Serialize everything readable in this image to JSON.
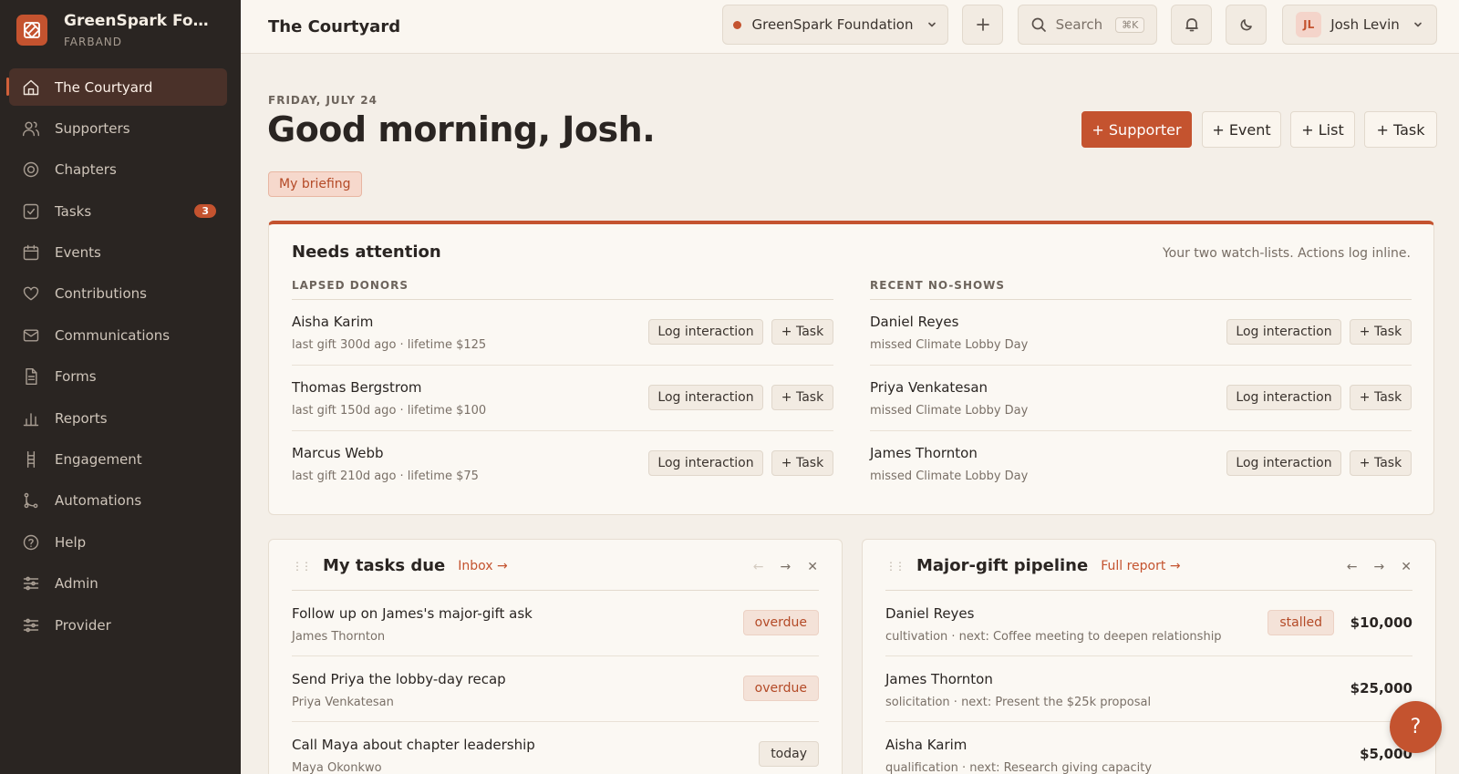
{
  "brand": {
    "name": "GreenSpark Foun...",
    "sub": "FARBAND",
    "logo_icon": "brand-logo-icon"
  },
  "sidebar": {
    "items": [
      {
        "label": "The Courtyard",
        "icon": "home-icon",
        "active": true
      },
      {
        "label": "Supporters",
        "icon": "users-icon"
      },
      {
        "label": "Chapters",
        "icon": "target-icon"
      },
      {
        "label": "Tasks",
        "icon": "checkbox-icon",
        "badge": "3"
      },
      {
        "label": "Events",
        "icon": "calendar-icon"
      },
      {
        "label": "Contributions",
        "icon": "heart-icon"
      },
      {
        "label": "Communications",
        "icon": "mail-icon"
      },
      {
        "label": "Forms",
        "icon": "document-icon"
      },
      {
        "label": "Reports",
        "icon": "bar-chart-icon"
      },
      {
        "label": "Engagement",
        "icon": "ladder-icon"
      },
      {
        "label": "Automations",
        "icon": "branch-icon"
      },
      {
        "label": "Help",
        "icon": "help-icon"
      },
      {
        "label": "Admin",
        "icon": "sliders-icon"
      },
      {
        "label": "Provider",
        "icon": "sliders-icon"
      }
    ]
  },
  "topbar": {
    "title": "The Courtyard",
    "org": "GreenSpark Foundation",
    "search_label": "Search",
    "search_kbd": "⌘K",
    "user_initials": "JL",
    "user_name": "Josh Levin"
  },
  "main": {
    "date": "FRIDAY, JULY 24",
    "greeting": "Good morning, Josh.",
    "briefing": "My briefing",
    "actions": {
      "supporter": "+ Supporter",
      "event": "+ Event",
      "list": "+ List",
      "task": "+ Task"
    }
  },
  "attention": {
    "title": "Needs attention",
    "note": "Your two watch-lists. Actions log inline.",
    "log_label": "Log interaction",
    "task_label": "+ Task",
    "lapsed": {
      "heading": "LAPSED DONORS",
      "rows": [
        {
          "name": "Aisha Karim",
          "meta": "last gift 300d ago · lifetime $125"
        },
        {
          "name": "Thomas Bergstrom",
          "meta": "last gift 150d ago · lifetime $100"
        },
        {
          "name": "Marcus Webb",
          "meta": "last gift 210d ago · lifetime $75"
        }
      ]
    },
    "noshows": {
      "heading": "RECENT NO-SHOWS",
      "rows": [
        {
          "name": "Daniel Reyes",
          "meta": "missed Climate Lobby Day"
        },
        {
          "name": "Priya Venkatesan",
          "meta": "missed Climate Lobby Day"
        },
        {
          "name": "James Thornton",
          "meta": "missed Climate Lobby Day"
        }
      ]
    }
  },
  "tasks": {
    "title": "My tasks due",
    "link": "Inbox →",
    "rows": [
      {
        "title": "Follow up on James's major-gift ask",
        "who": "James Thornton",
        "status": "overdue"
      },
      {
        "title": "Send Priya the lobby-day recap",
        "who": "Priya Venkatesan",
        "status": "overdue"
      },
      {
        "title": "Call Maya about chapter leadership",
        "who": "Maya Okonkwo",
        "status": "today"
      }
    ]
  },
  "pipeline": {
    "title": "Major-gift pipeline",
    "link": "Full report →",
    "rows": [
      {
        "name": "Daniel Reyes",
        "meta": "cultivation · next: Coffee meeting to deepen relationship",
        "status": "stalled",
        "amount": "$10,000"
      },
      {
        "name": "James Thornton",
        "meta": "solicitation · next: Present the $25k proposal",
        "amount": "$25,000"
      },
      {
        "name": "Aisha Karim",
        "meta": "qualification · next: Research giving capacity",
        "amount": "$5,000"
      }
    ]
  },
  "widget_controls": {
    "prev": "←",
    "next": "→",
    "close": "✕"
  },
  "help_fab": "?",
  "colors": {
    "accent": "#c4532f",
    "sidebar_bg": "#2a2522",
    "page_bg": "#f4efe8"
  }
}
